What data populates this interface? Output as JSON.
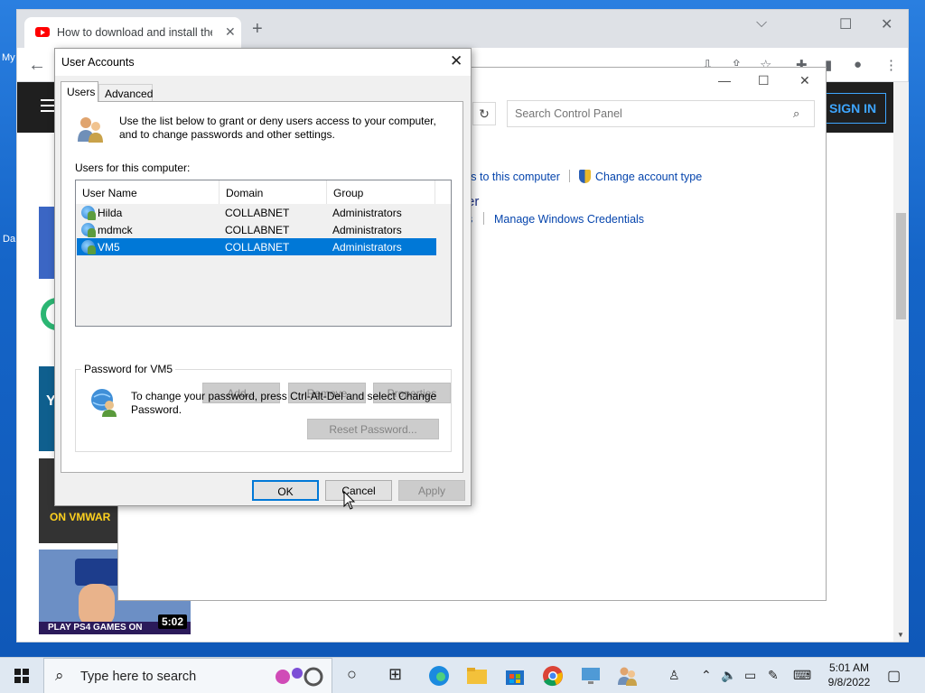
{
  "browser": {
    "tab_title": "How to download and install the",
    "tab_close": "✕",
    "new_tab": "+",
    "minimize": "⌵",
    "maximize": "☐",
    "close": "✕",
    "back": "←",
    "signin": "SIGN IN"
  },
  "youtube": {
    "thumb4_caption": "ON VMWAR",
    "thumb5_caption": "PLAY PS4 GAMES ON",
    "thumb5_duration": "5:02",
    "side_my": "My",
    "side_da": "Da",
    "side_y": "Y"
  },
  "control_panel": {
    "search_placeholder": "Search Control Panel",
    "link_access": "ss to this computer",
    "link_change_type": "Change account type",
    "heading_fragment": "er",
    "link_fragment": "s",
    "link_credentials": "Manage Windows Credentials"
  },
  "dialog": {
    "title": "User Accounts",
    "tabs": [
      "Users",
      "Advanced"
    ],
    "intro": "Use the list below to grant or deny users access to your computer, and to change passwords and other settings.",
    "list_label": "Users for this computer:",
    "columns": [
      "User Name",
      "Domain",
      "Group"
    ],
    "users": [
      {
        "name": "Hilda",
        "domain": "COLLABNET",
        "group": "Administrators",
        "selected": false
      },
      {
        "name": "mdmck",
        "domain": "COLLABNET",
        "group": "Administrators",
        "selected": false
      },
      {
        "name": "VM5",
        "domain": "COLLABNET",
        "group": "Administrators",
        "selected": true
      }
    ],
    "btn_add": "Add...",
    "btn_remove": "Remove",
    "btn_properties": "Properties",
    "password_group_title": "Password for VM5",
    "password_text": "To change your password, press Ctrl-Alt-Del and select Change Password.",
    "btn_reset": "Reset Password...",
    "btn_ok": "OK",
    "btn_cancel": "Cancel",
    "btn_apply": "Apply"
  },
  "taskbar": {
    "search_placeholder": "Type here to search",
    "time": "5:01 AM",
    "date": "9/8/2022"
  },
  "colors": {
    "selection": "#0078d7",
    "link": "#0645ad",
    "desktop": "#1565c8"
  }
}
